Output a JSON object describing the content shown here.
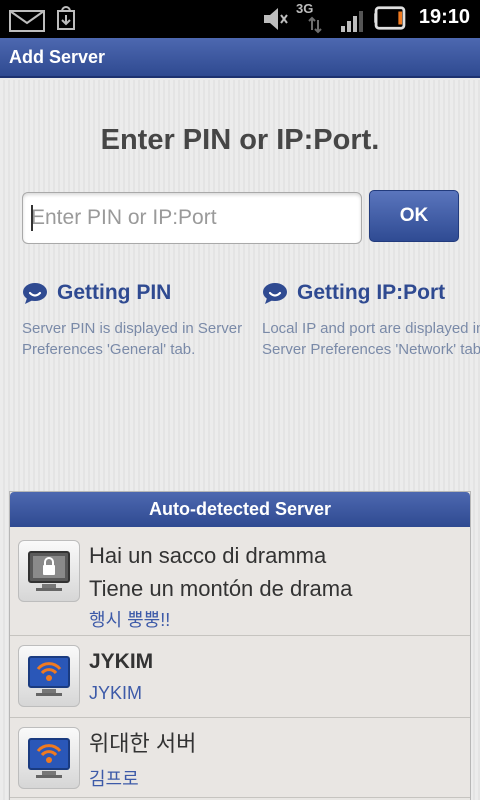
{
  "status_bar": {
    "time": "19:10",
    "network": "3G",
    "icons": [
      "mail-icon",
      "download-icon",
      "mute-icon",
      "signal-icon",
      "battery-icon"
    ]
  },
  "title_bar": {
    "title": "Add Server"
  },
  "main": {
    "heading": "Enter PIN or IP:Port.",
    "input_placeholder": "Enter PIN or IP:Port",
    "input_value": "",
    "ok_label": "OK",
    "help": [
      {
        "title": "Getting PIN",
        "description": "Server PIN is displayed in Server Preferences 'General' tab."
      },
      {
        "title": "Getting IP:Port",
        "description": "Local IP and port are displayed in Server Preferences 'Network' tab."
      }
    ]
  },
  "servers": {
    "header": "Auto-detected Server",
    "items": [
      {
        "name": "Hai un sacco di dramma Tiene un montón de drama",
        "name_line1": "Hai un sacco di dramma",
        "name_line2": "Tiene un montón de drama",
        "sub": "행시 뿡뿡!!",
        "icon": "lock-monitor-icon"
      },
      {
        "name": "JYKIM",
        "sub": "JYKIM",
        "icon": "wifi-monitor-icon"
      },
      {
        "name": "위대한 서버",
        "sub": "김프로",
        "icon": "wifi-monitor-icon"
      }
    ]
  },
  "colors": {
    "accent": "#2f4a91",
    "accent_light": "#4d68b0",
    "help_text": "#7a8aa8",
    "background": "#ebebeb"
  }
}
